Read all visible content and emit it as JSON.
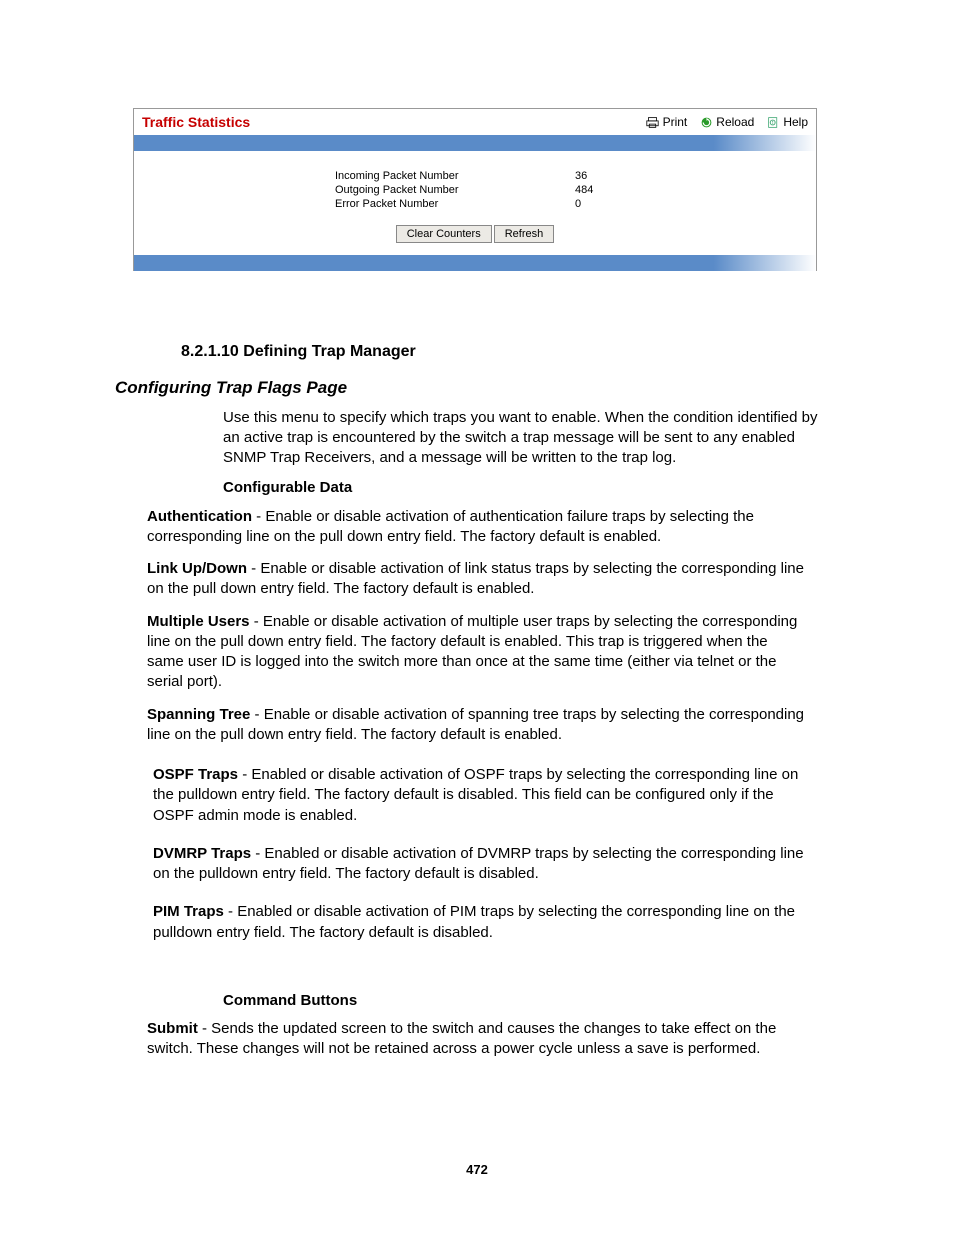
{
  "panel": {
    "title": "Traffic Statistics",
    "actions": {
      "print": "Print",
      "reload": "Reload",
      "help": "Help"
    },
    "stats": {
      "incoming_label": "Incoming Packet Number",
      "incoming_value": "36",
      "outgoing_label": "Outgoing Packet Number",
      "outgoing_value": "484",
      "error_label": "Error Packet Number",
      "error_value": "0"
    },
    "buttons": {
      "clear": "Clear Counters",
      "refresh": "Refresh"
    }
  },
  "doc": {
    "section_heading_num": "8.2.1.10",
    "section_heading_text": " Defining Trap Manager",
    "sub_heading": "Configuring Trap Flags Page",
    "intro": "Use this menu to specify which traps you want to enable. When the condition identified by an active trap is encountered by the switch a trap message will be sent to any enabled SNMP Trap Receivers, and a message will be written to the trap log.",
    "configurable_data": "Configurable Data",
    "auth_b": "Authentication",
    "auth_t": " - Enable or disable activation of authentication failure traps by selecting the corresponding line on the pull down entry field. The factory default is enabled.",
    "link_b": "Link Up/Down",
    "link_t": " - Enable or disable activation of link status traps by selecting the corresponding line on the pull down entry field. The factory default is enabled.",
    "multi_b": "Multiple Users",
    "multi_t": " - Enable or disable activation of multiple user traps by selecting the corresponding line on the pull down entry field. The factory default is enabled. This trap is triggered when the same user ID is logged into the switch more than once at the same time (either via telnet or the serial port).",
    "span_b": "Spanning Tree",
    "span_t": " - Enable or disable activation of spanning tree traps by selecting the corresponding line on the pull down entry field. The factory default is enabled.",
    "ospf_b": "OSPF Traps",
    "ospf_t": " - Enabled or disable activation of OSPF traps by selecting the corresponding line on the pulldown entry field. The factory default is disabled. This field can be configured only if the OSPF admin mode is enabled.",
    "dvmrp_b": "DVMRP Traps",
    "dvmrp_t": " - Enabled or disable activation of DVMRP traps by selecting the corresponding line on the pulldown entry field. The factory default is disabled.",
    "pim_b": "PIM Traps",
    "pim_t": " - Enabled or disable activation of PIM traps by selecting the corresponding line on the pulldown entry field. The factory default is disabled.",
    "command_buttons": "Command Buttons",
    "submit_b": "Submit",
    "submit_t": " - Sends the updated screen to the switch and causes the changes to take effect on the switch. These changes will not be retained across a power cycle unless a save is performed.",
    "page_number": "472"
  }
}
